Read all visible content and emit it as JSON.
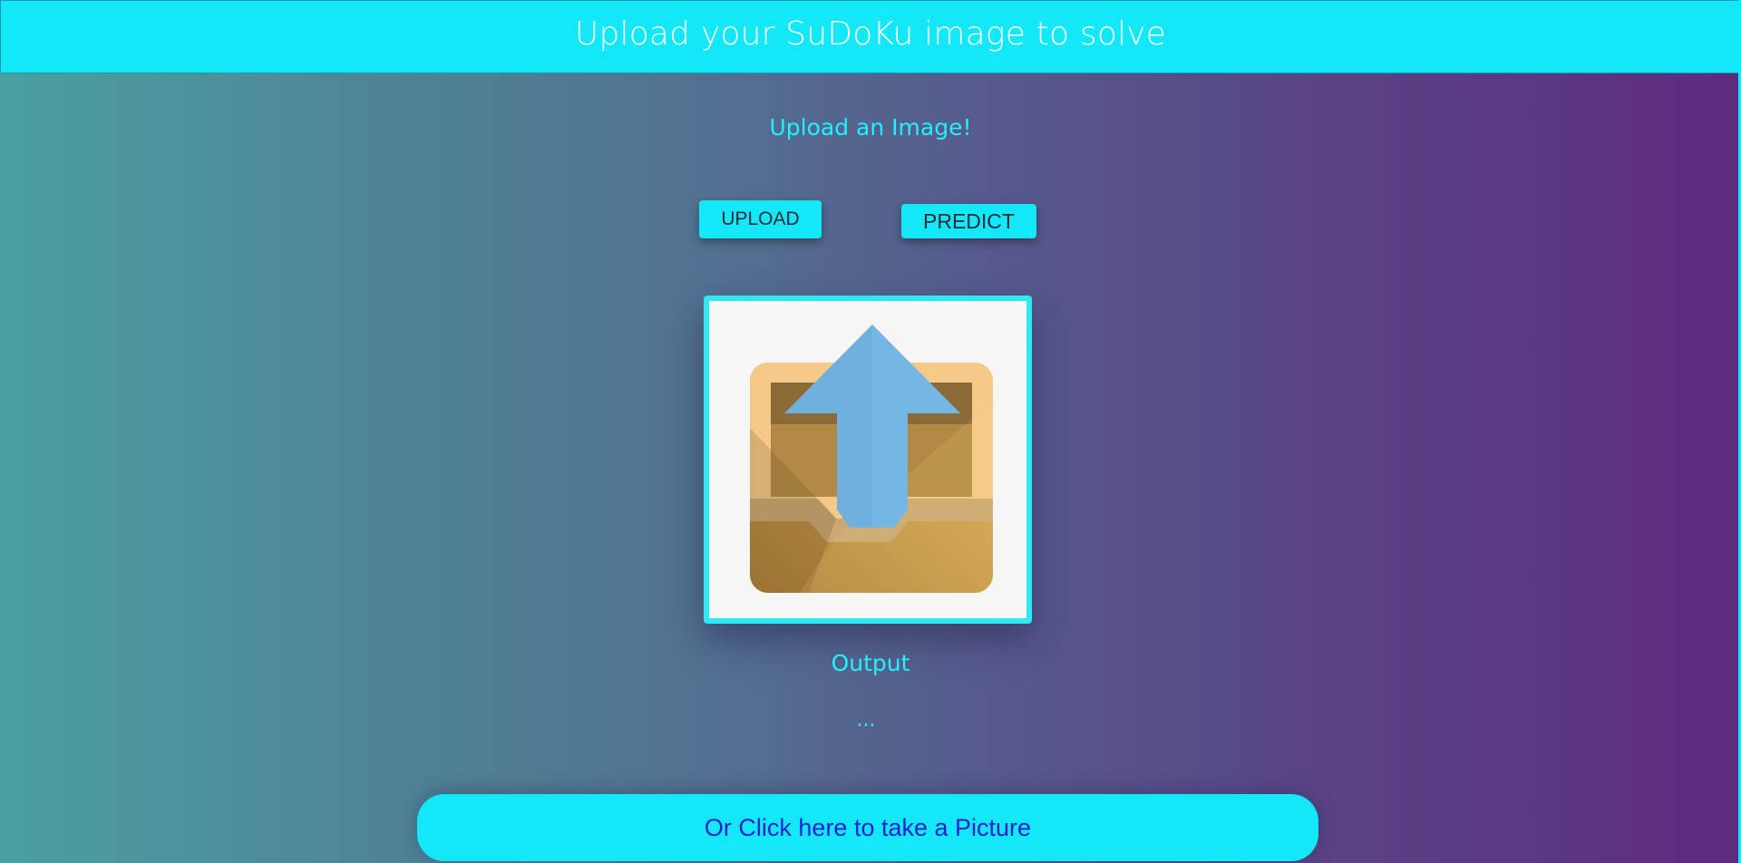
{
  "header": {
    "title": "Upload your SuDoKu image to solve"
  },
  "main": {
    "upload_label": "Upload an Image!",
    "upload_button": "UPLOAD",
    "predict_button": "PREDICT",
    "preview_icon": "upload-box-icon",
    "output_label": "Output",
    "output_value": "..."
  },
  "footer": {
    "camera_button": "Or Click here to take a Picture"
  },
  "colors": {
    "accent": "#12e8f8",
    "label_text": "#22f0ff",
    "camera_text": "#2a1fd6"
  }
}
